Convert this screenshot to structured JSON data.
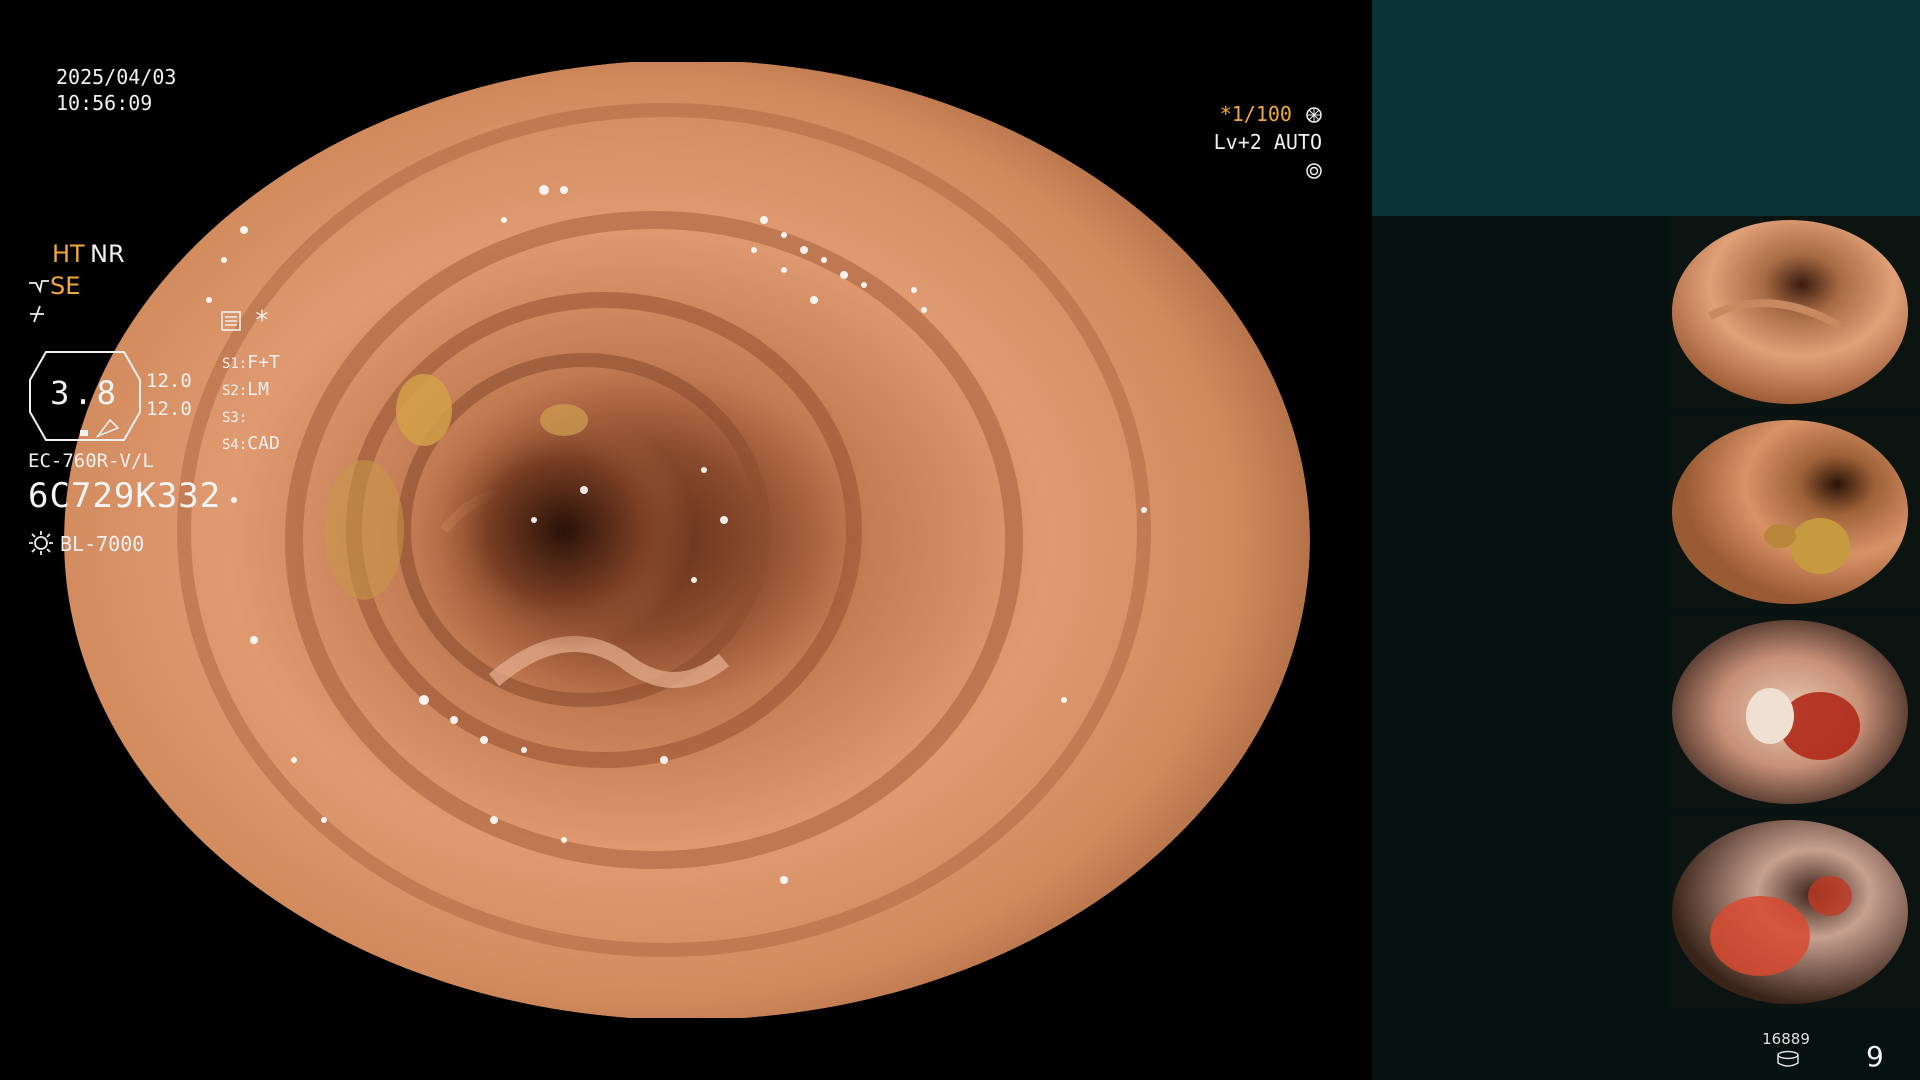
{
  "main": {
    "date": "2025/04/03",
    "time": "10:56:09",
    "zoom": "*1/100",
    "level": "Lv+2 AUTO"
  },
  "panel": {
    "ht": "HT",
    "nr": "NR",
    "se": "SE",
    "gauge_value": "3.8",
    "param1": "12.0",
    "param2": "12.0",
    "s1": {
      "key": "S1:",
      "value": "F+T"
    },
    "s2": {
      "key": "S2:",
      "value": "LM"
    },
    "s3": {
      "key": "S3:",
      "value": ""
    },
    "s4": {
      "key": "S4:",
      "value": "CAD"
    },
    "scope_model": "EC-760R-V/L",
    "serial": "6C729K332",
    "light_source": "BL-7000"
  },
  "counters": {
    "image_count": "16889",
    "frame_number": "9"
  },
  "icons": {
    "aperture": "aperture-icon",
    "auto": "auto-iris-icon",
    "structure": "structure-enhance-icon",
    "flicker": "flicker-icon",
    "setting": "setting-icon",
    "light": "light-source-icon",
    "database": "database-icon"
  },
  "colors": {
    "accent": "#f3a93a",
    "panel_bg": "#061210",
    "panel_top": "#0a3433",
    "tissue": "#d48a5e"
  }
}
